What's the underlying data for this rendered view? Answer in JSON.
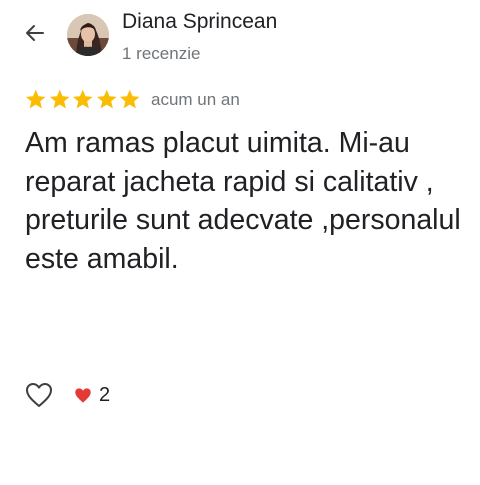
{
  "header": {
    "back_icon": "arrow-left-icon",
    "user_name": "Diana Sprincean",
    "review_count": "1 recenzie",
    "avatar_description": "profile photo"
  },
  "review": {
    "rating": 5,
    "max_rating": 5,
    "star_color": "#fbbc04",
    "date": "acum un an",
    "text": "Am ramas placut uimita. Mi-au reparat jacheta rapid si calitativ , preturile sunt adecvate ,personalul este amabil."
  },
  "actions": {
    "like_icon": "heart-outline-icon",
    "reaction_icon": "red-heart-icon",
    "reaction_color": "#e53935",
    "reaction_count": "2"
  }
}
